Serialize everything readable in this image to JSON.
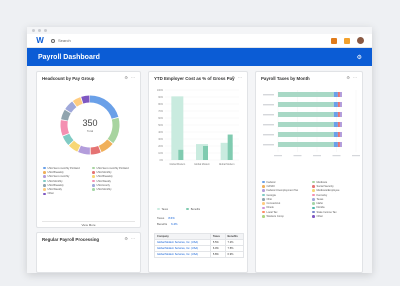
{
  "header": {
    "search_placeholder": "Search",
    "logo_glyph": "W"
  },
  "banner": {
    "title": "Payroll Dashboard"
  },
  "headcount": {
    "title": "Headcount by Pay Group",
    "center_value": "350",
    "center_label": "Total",
    "view_more": "View More",
    "legend": [
      {
        "label": "USA Semi-monthly Portland",
        "color": "#6aa0e8"
      },
      {
        "label": "USA Semi-monthly Portland",
        "color": "#a8d4a0"
      },
      {
        "label": "USA Biweekly",
        "color": "#f0b05a"
      },
      {
        "label": "USA Monthly",
        "color": "#e57373"
      },
      {
        "label": "USA Semi-monthly",
        "color": "#b39ddb"
      },
      {
        "label": "USA Biweekly",
        "color": "#f7d775"
      },
      {
        "label": "USA Monthly",
        "color": "#80cbc4"
      },
      {
        "label": "USA Weekly",
        "color": "#f48fb1"
      },
      {
        "label": "USA Biweekly",
        "color": "#90a4ae"
      },
      {
        "label": "USA Hourly",
        "color": "#9fa8da"
      },
      {
        "label": "USA Weekly",
        "color": "#ffcc80"
      },
      {
        "label": "USA Monthly",
        "color": "#a5d6a7"
      },
      {
        "label": "Other",
        "color": "#7e57c2"
      }
    ],
    "segments": [
      {
        "value": 21,
        "color": "#6aa0e8"
      },
      {
        "value": 15,
        "color": "#a8d4a0"
      },
      {
        "value": 8,
        "color": "#f0b05a"
      },
      {
        "value": 6,
        "color": "#e57373"
      },
      {
        "value": 7,
        "color": "#b39ddb"
      },
      {
        "value": 6,
        "color": "#f7d775"
      },
      {
        "value": 6,
        "color": "#80cbc4"
      },
      {
        "value": 9,
        "color": "#f48fb1"
      },
      {
        "value": 6,
        "color": "#90a4ae"
      },
      {
        "value": 6,
        "color": "#9fa8da"
      },
      {
        "value": 5,
        "color": "#ffcc80"
      },
      {
        "value": 5,
        "color": "#7e57c2"
      }
    ]
  },
  "ytd": {
    "title": "YTD Employer Cost as % of Gross Pay",
    "legend_a": "Taxes",
    "legend_b": "Benefits",
    "taxes_label": "Taxes",
    "taxes_value": "8.6%",
    "benefits_label": "Benefits",
    "benefits_value": "6.4%",
    "table": {
      "h_company": "Company",
      "h_group": "Total",
      "h_taxes": "Taxes",
      "h_benefits": "Benefits",
      "rows": [
        {
          "name": "Global Modern Services, Inc. (USA)",
          "taxes": "5.5%",
          "benefits": "7.2%"
        },
        {
          "name": "Global Modern Services, Inc. (USA)",
          "taxes": "6.0%",
          "benefits": "7.5%"
        },
        {
          "name": "Global Modern Services, Inc. (USA)",
          "taxes": "5.8%",
          "benefits": "6.9%"
        }
      ]
    }
  },
  "chart_data": [
    {
      "type": "bar",
      "categories": [
        "Global Modern",
        "Global Modern",
        "Global Modern"
      ],
      "series": [
        {
          "values": [
            100,
            25,
            27
          ],
          "color": "#c9ebdf"
        },
        {
          "values": [
            16,
            22,
            40
          ],
          "color": "#80cbb0"
        }
      ],
      "ylim": [
        0,
        110
      ]
    },
    {
      "type": "bar",
      "categories": [
        "",
        "",
        "",
        "",
        "",
        ""
      ],
      "series": [
        {
          "values": [
            55,
            55,
            55,
            55,
            55,
            55
          ],
          "color": "#a8d8c5"
        },
        {
          "values": [
            4,
            4,
            4,
            4,
            4,
            4
          ],
          "color": "#6aa0e8"
        },
        {
          "values": [
            2,
            2,
            2,
            2,
            2,
            2
          ],
          "color": "#e57373"
        },
        {
          "values": [
            2,
            2,
            2,
            2,
            2,
            2
          ],
          "color": "#b39ddb"
        }
      ]
    }
  ],
  "taxes": {
    "title": "Payroll Taxes by Month",
    "legend": [
      {
        "label": "Federal",
        "color": "#6aa0e8"
      },
      {
        "label": "Medicare",
        "color": "#a8d4a0"
      },
      {
        "label": "OASDI",
        "color": "#f0b05a"
      },
      {
        "label": "Social Security",
        "color": "#e57373"
      },
      {
        "label": "Federal Unemployment Tax",
        "color": "#b39ddb"
      },
      {
        "label": "Medicare/Employee",
        "color": "#f7d775"
      },
      {
        "label": "Georgia",
        "color": "#80cbc4"
      },
      {
        "label": "Kentucky",
        "color": "#f48fb1"
      },
      {
        "label": "Ohio",
        "color": "#90a4ae"
      },
      {
        "label": "Texas",
        "color": "#9fa8da"
      },
      {
        "label": "Connecticut",
        "color": "#ffcc80"
      },
      {
        "label": "Idaho",
        "color": "#a5d6a7"
      },
      {
        "label": "Illinois",
        "color": "#ce93d8"
      },
      {
        "label": "Florida",
        "color": "#4db6ac"
      },
      {
        "label": "Local Tax",
        "color": "#ff8a65"
      },
      {
        "label": "State Income Tax",
        "color": "#7986cb"
      },
      {
        "label": "Workers Comp",
        "color": "#aed581"
      },
      {
        "label": "Other",
        "color": "#7e57c2"
      }
    ]
  },
  "regular": {
    "title": "Regular Payroll Processing"
  }
}
